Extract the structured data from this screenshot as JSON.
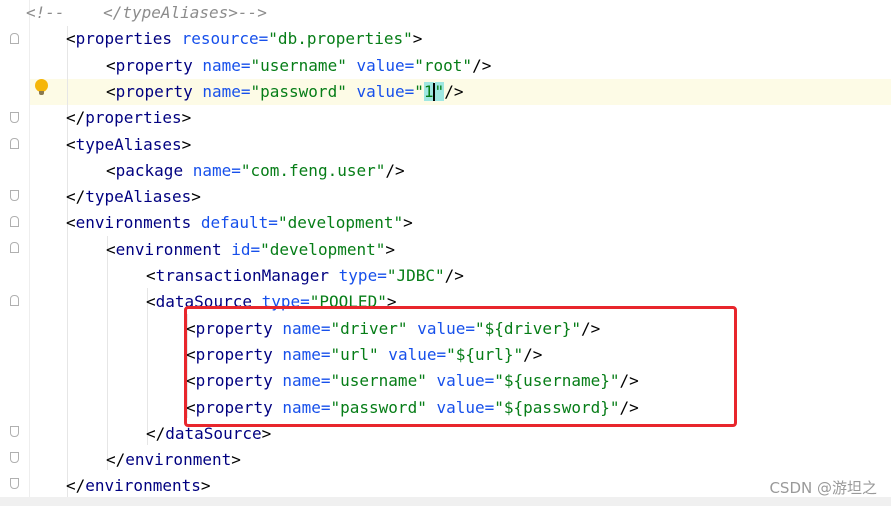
{
  "editor": {
    "lines": [
      {
        "indent": 0,
        "parts": [
          {
            "t": "<!--    </typeAliases>-->",
            "c": "c-comment"
          }
        ]
      },
      {
        "indent": 1,
        "parts": [
          {
            "t": "<",
            "c": "c-punct"
          },
          {
            "t": "properties",
            "c": "c-tag"
          },
          {
            "t": " resource=",
            "c": "c-attr"
          },
          {
            "t": "\"db.properties\"",
            "c": "c-val"
          },
          {
            "t": ">",
            "c": "c-punct"
          }
        ]
      },
      {
        "indent": 2,
        "parts": [
          {
            "t": "<",
            "c": "c-punct"
          },
          {
            "t": "property",
            "c": "c-tag"
          },
          {
            "t": " name=",
            "c": "c-attr"
          },
          {
            "t": "\"username\"",
            "c": "c-val"
          },
          {
            "t": " value=",
            "c": "c-attr"
          },
          {
            "t": "\"root\"",
            "c": "c-val"
          },
          {
            "t": "/>",
            "c": "c-punct"
          }
        ]
      },
      {
        "indent": 2,
        "parts": [
          {
            "t": "<",
            "c": "c-punct"
          },
          {
            "t": "property",
            "c": "c-tag"
          },
          {
            "t": " name=",
            "c": "c-attr"
          },
          {
            "t": "\"password\"",
            "c": "c-val"
          },
          {
            "t": " value=",
            "c": "c-attr"
          },
          {
            "t": "\"1\"",
            "c": "c-val caret-line"
          },
          {
            "t": "/>",
            "c": "c-punct"
          }
        ]
      },
      {
        "indent": 1,
        "parts": [
          {
            "t": "</",
            "c": "c-punct"
          },
          {
            "t": "properties",
            "c": "c-tag"
          },
          {
            "t": ">",
            "c": "c-punct"
          }
        ]
      },
      {
        "indent": 1,
        "parts": [
          {
            "t": "<",
            "c": "c-punct"
          },
          {
            "t": "typeAliases",
            "c": "c-tag"
          },
          {
            "t": ">",
            "c": "c-punct"
          }
        ]
      },
      {
        "indent": 2,
        "parts": [
          {
            "t": "<",
            "c": "c-punct"
          },
          {
            "t": "package",
            "c": "c-tag"
          },
          {
            "t": " name=",
            "c": "c-attr"
          },
          {
            "t": "\"com.feng.user\"",
            "c": "c-val"
          },
          {
            "t": "/>",
            "c": "c-punct"
          }
        ]
      },
      {
        "indent": 1,
        "parts": [
          {
            "t": "</",
            "c": "c-punct"
          },
          {
            "t": "typeAliases",
            "c": "c-tag"
          },
          {
            "t": ">",
            "c": "c-punct"
          }
        ]
      },
      {
        "indent": 1,
        "parts": [
          {
            "t": "<",
            "c": "c-punct"
          },
          {
            "t": "environments",
            "c": "c-tag"
          },
          {
            "t": " default=",
            "c": "c-attr"
          },
          {
            "t": "\"development\"",
            "c": "c-val"
          },
          {
            "t": ">",
            "c": "c-punct"
          }
        ]
      },
      {
        "indent": 2,
        "parts": [
          {
            "t": "<",
            "c": "c-punct"
          },
          {
            "t": "environment",
            "c": "c-tag"
          },
          {
            "t": " id=",
            "c": "c-attr"
          },
          {
            "t": "\"development\"",
            "c": "c-val"
          },
          {
            "t": ">",
            "c": "c-punct"
          }
        ]
      },
      {
        "indent": 3,
        "parts": [
          {
            "t": "<",
            "c": "c-punct"
          },
          {
            "t": "transactionManager",
            "c": "c-tag"
          },
          {
            "t": " type=",
            "c": "c-attr"
          },
          {
            "t": "\"JDBC\"",
            "c": "c-val"
          },
          {
            "t": "/>",
            "c": "c-punct"
          }
        ]
      },
      {
        "indent": 3,
        "parts": [
          {
            "t": "<",
            "c": "c-punct"
          },
          {
            "t": "dataSource",
            "c": "c-tag"
          },
          {
            "t": " type=",
            "c": "c-attr"
          },
          {
            "t": "\"POOLED\"",
            "c": "c-val"
          },
          {
            "t": ">",
            "c": "c-punct"
          }
        ]
      },
      {
        "indent": 4,
        "parts": [
          {
            "t": "<",
            "c": "c-punct"
          },
          {
            "t": "property",
            "c": "c-tag"
          },
          {
            "t": " name=",
            "c": "c-attr"
          },
          {
            "t": "\"driver\"",
            "c": "c-val"
          },
          {
            "t": " value=",
            "c": "c-attr"
          },
          {
            "t": "\"${driver}\"",
            "c": "c-val"
          },
          {
            "t": "/>",
            "c": "c-punct"
          }
        ]
      },
      {
        "indent": 4,
        "parts": [
          {
            "t": "<",
            "c": "c-punct"
          },
          {
            "t": "property",
            "c": "c-tag"
          },
          {
            "t": " name=",
            "c": "c-attr"
          },
          {
            "t": "\"url\"",
            "c": "c-val"
          },
          {
            "t": " value=",
            "c": "c-attr"
          },
          {
            "t": "\"${url}\"",
            "c": "c-val"
          },
          {
            "t": "/>",
            "c": "c-punct"
          }
        ]
      },
      {
        "indent": 4,
        "parts": [
          {
            "t": "<",
            "c": "c-punct"
          },
          {
            "t": "property",
            "c": "c-tag"
          },
          {
            "t": " name=",
            "c": "c-attr"
          },
          {
            "t": "\"username\"",
            "c": "c-val"
          },
          {
            "t": " value=",
            "c": "c-attr"
          },
          {
            "t": "\"${username}\"",
            "c": "c-val"
          },
          {
            "t": "/>",
            "c": "c-punct"
          }
        ]
      },
      {
        "indent": 4,
        "parts": [
          {
            "t": "<",
            "c": "c-punct"
          },
          {
            "t": "property",
            "c": "c-tag"
          },
          {
            "t": " name=",
            "c": "c-attr"
          },
          {
            "t": "\"password\"",
            "c": "c-val"
          },
          {
            "t": " value=",
            "c": "c-attr"
          },
          {
            "t": "\"${password}\"",
            "c": "c-val"
          },
          {
            "t": "/>",
            "c": "c-punct"
          }
        ]
      },
      {
        "indent": 3,
        "parts": [
          {
            "t": "</",
            "c": "c-punct"
          },
          {
            "t": "dataSource",
            "c": "c-tag"
          },
          {
            "t": ">",
            "c": "c-punct"
          }
        ]
      },
      {
        "indent": 2,
        "parts": [
          {
            "t": "</",
            "c": "c-punct"
          },
          {
            "t": "environment",
            "c": "c-tag"
          },
          {
            "t": ">",
            "c": "c-punct"
          }
        ]
      },
      {
        "indent": 1,
        "parts": [
          {
            "t": "</",
            "c": "c-punct"
          },
          {
            "t": "environments",
            "c": "c-tag"
          },
          {
            "t": ">",
            "c": "c-punct"
          }
        ]
      }
    ],
    "highlight_color": "#e8262c",
    "intention_icon": "lightbulb-icon"
  },
  "watermark": "CSDN @游坦之"
}
